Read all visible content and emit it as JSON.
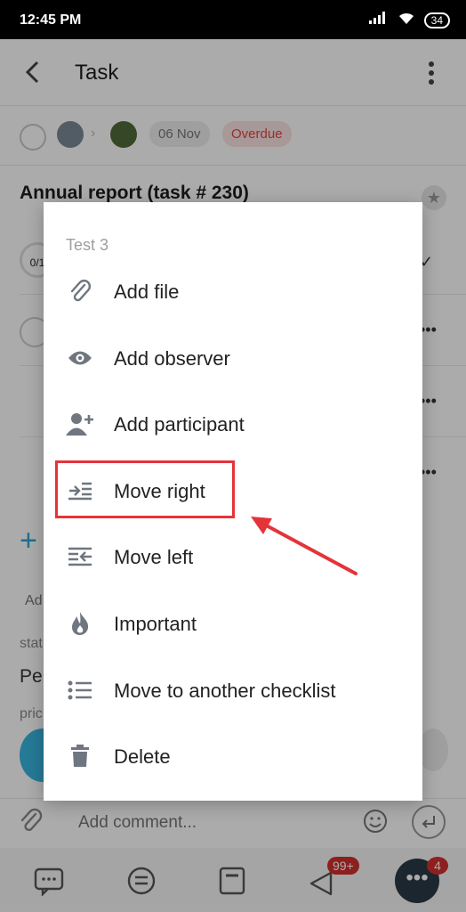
{
  "status_bar": {
    "time": "12:45 PM",
    "battery": "34"
  },
  "app_bar": {
    "title": "Task"
  },
  "task_meta": {
    "date": "06 Nov",
    "status": "Overdue"
  },
  "task": {
    "title": "Annual report (task # 230)"
  },
  "background": {
    "progress_label": "0/1",
    "add_label": "Ad",
    "status_label": "stat",
    "status_value": "Pe",
    "priority_label": "pric"
  },
  "comment": {
    "placeholder": "Add comment..."
  },
  "bottom_nav": {
    "notifications_badge": "99+",
    "more_badge": "4"
  },
  "menu": {
    "header": "Test 3",
    "items": [
      {
        "label": "Add file",
        "icon": "paperclip-icon"
      },
      {
        "label": "Add observer",
        "icon": "eye-icon"
      },
      {
        "label": "Add participant",
        "icon": "add-person-icon"
      },
      {
        "label": "Move right",
        "icon": "indent-right-icon"
      },
      {
        "label": "Move left",
        "icon": "indent-left-icon"
      },
      {
        "label": "Important",
        "icon": "flame-icon"
      },
      {
        "label": "Move to another checklist",
        "icon": "list-icon"
      },
      {
        "label": "Delete",
        "icon": "trash-icon"
      }
    ]
  },
  "colors": {
    "highlight": "#e5333a",
    "overdue": "#e0463f",
    "icon_gray": "#6f7680",
    "badge": "#d32f2f"
  }
}
